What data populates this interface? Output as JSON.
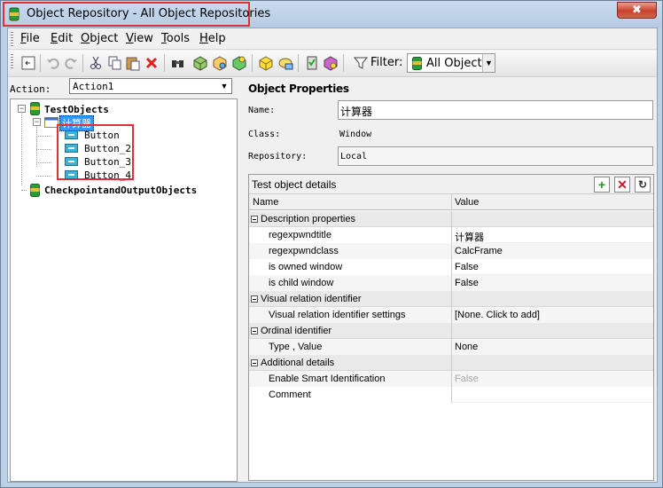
{
  "window": {
    "title": "Object Repository - All Object Repositories",
    "close_symbol": "✖"
  },
  "menu": [
    "File",
    "Edit",
    "Object",
    "View",
    "Tools",
    "Help"
  ],
  "toolbar": {
    "filter_label": "Filter:",
    "filter_value": "All Object",
    "icons": [
      "collapse-icon",
      "undo-icon",
      "redo-icon",
      "cut-icon",
      "copy-icon",
      "paste-icon",
      "delete-icon",
      "find-icon",
      "add-objects-icon",
      "object-spy-icon",
      "highlight-icon",
      "export-icon",
      "associate-icon",
      "add-checkpoint-icon",
      "properties-icon",
      "filter-icon"
    ]
  },
  "action": {
    "label": "Action:",
    "value": "Action1"
  },
  "tree": {
    "root": "TestObjects",
    "window_node": "计算器",
    "children": [
      "Button",
      "Button_2",
      "Button_3",
      "Button_4"
    ],
    "second_root": "CheckpointandOutputObjects"
  },
  "properties": {
    "title": "Object Properties",
    "name_label": "Name:",
    "name_value": "计算器",
    "class_label": "Class:",
    "class_value": "Window",
    "repository_label": "Repository:",
    "repository_value": "Local"
  },
  "details": {
    "title": "Test object details",
    "columns": [
      "Name",
      "Value"
    ],
    "rows": [
      {
        "type": "group",
        "name": "Description properties"
      },
      {
        "type": "prop",
        "name": "regexpwndtitle",
        "value": "计算器"
      },
      {
        "type": "prop",
        "name": "regexpwndclass",
        "value": "CalcFrame"
      },
      {
        "type": "prop",
        "name": "is owned window",
        "value": "False"
      },
      {
        "type": "prop",
        "name": "is child window",
        "value": "False"
      },
      {
        "type": "group",
        "name": "Visual relation identifier"
      },
      {
        "type": "prop",
        "name": "Visual relation identifier settings",
        "value": "[None. Click to add]"
      },
      {
        "type": "group",
        "name": "Ordinal identifier"
      },
      {
        "type": "prop",
        "name": "Type , Value",
        "value": "None"
      },
      {
        "type": "group",
        "name": "Additional details"
      },
      {
        "type": "prop",
        "name": "Enable Smart Identification",
        "value": "False",
        "disabled": true
      },
      {
        "type": "prop",
        "name": "Comment",
        "value": ""
      }
    ]
  },
  "colors": {
    "highlight": "#e0303a",
    "selection": "#3399ff",
    "frame": "#bcd0e6"
  }
}
